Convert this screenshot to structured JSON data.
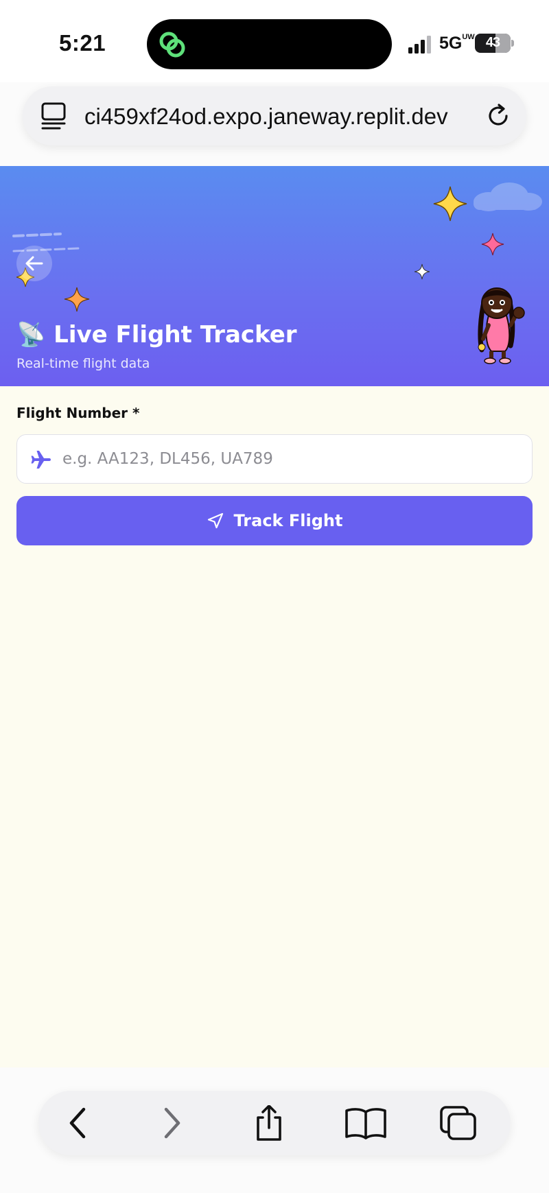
{
  "status_bar": {
    "time": "5:21",
    "network": "5G",
    "network_sup": "UW",
    "battery": "43"
  },
  "browser": {
    "url": "ci459xf24od.expo.janeway.replit.dev"
  },
  "header": {
    "title": "📡 Live Flight Tracker",
    "subtitle": "Real-time flight data"
  },
  "form": {
    "flight_number_label": "Flight Number *",
    "flight_number_placeholder": "e.g. AA123, DL456, UA789",
    "flight_number_value": "",
    "submit_label": "Track Flight"
  },
  "colors": {
    "accent": "#6860f0",
    "header_gradient_top": "#5a8cf0",
    "header_gradient_bottom": "#6c5ff0",
    "page_background": "#fdfcf0",
    "island_icon": "#5ee07a"
  },
  "icons": {
    "island": "linked-rings-icon",
    "back": "arrow-left-icon",
    "input": "airplane-icon",
    "submit": "navigation-arrow-icon",
    "toolbar": [
      "chevron-left-icon",
      "chevron-right-icon",
      "share-icon",
      "bookmarks-icon",
      "tabs-icon"
    ]
  }
}
